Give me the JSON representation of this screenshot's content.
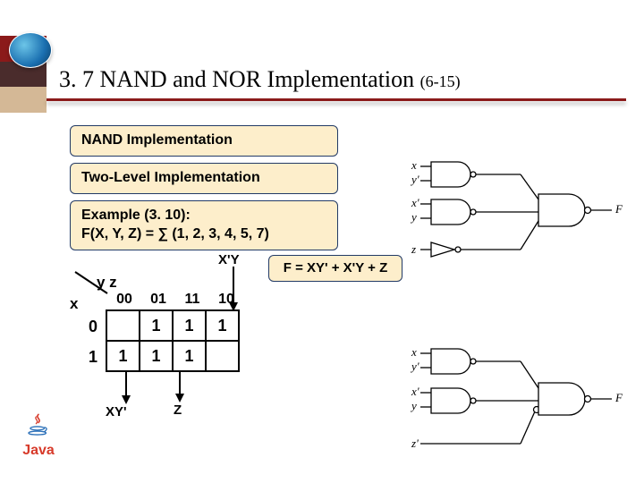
{
  "header": {
    "section_number": "3. 7",
    "title_main": "NAND and NOR Implementation",
    "title_sub": "(6-15)"
  },
  "boxes": {
    "nand": "NAND Implementation",
    "two_level": "Two-Level Implementation",
    "example_line1": "Example (3. 10):",
    "example_line2": "F(X, Y, Z) = ∑ (1, 2, 3, 4, 5, 7)",
    "f_equation": "F = XY' + X'Y + Z"
  },
  "kmap": {
    "var_top": "y z",
    "var_left": "x",
    "cols": [
      "00",
      "01",
      "11",
      "10"
    ],
    "rows": [
      "0",
      "1"
    ],
    "cells": [
      [
        "",
        "1",
        "1",
        "1"
      ],
      [
        "1",
        "1",
        "1",
        ""
      ]
    ],
    "label_top": "X'Y",
    "label_bottom_left": "XY'",
    "label_bottom_right": "Z"
  },
  "circuit1": {
    "inputs": [
      "x",
      "y'",
      "x'",
      "y",
      "z"
    ],
    "output": "F"
  },
  "circuit2": {
    "inputs": [
      "x",
      "y'",
      "x'",
      "y",
      "z'"
    ],
    "output": "F"
  },
  "logo": {
    "text": "Java"
  }
}
